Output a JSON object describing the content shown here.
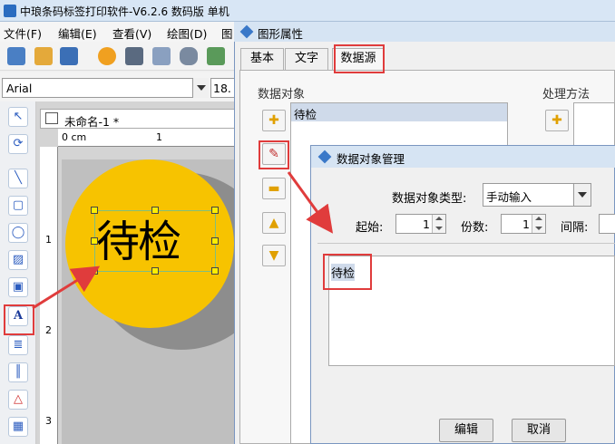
{
  "app": {
    "title": "中琅条码标签打印软件-V6.2.6 数码版 单机",
    "menu": [
      "文件(F)",
      "编辑(E)",
      "查看(V)",
      "绘图(D)",
      "图"
    ]
  },
  "font_bar": {
    "font_name": "Arial",
    "font_size": "18."
  },
  "document": {
    "tab_label": "未命名-1 *",
    "ruler_unit": "0 cm",
    "ruler_ticks": [
      "1",
      "1",
      "2",
      "3"
    ],
    "label_text": "待检"
  },
  "property_dialog": {
    "title": "图形属性",
    "tabs": [
      "基本",
      "文字",
      "数据源"
    ],
    "active_tab": "数据源",
    "data_objects_label": "数据对象",
    "processing_label": "处理方法",
    "data_objects": [
      "待检"
    ]
  },
  "manager_dialog": {
    "title": "数据对象管理",
    "type_label": "数据对象类型:",
    "type_value": "手动输入",
    "start_label": "起始:",
    "start_value": "1",
    "copies_label": "份数:",
    "copies_value": "1",
    "interval_label": "间隔:",
    "content_value": "待检",
    "edit_button": "编辑",
    "cancel_button": "取消"
  },
  "colors": {
    "label_circle": "#f7c300",
    "highlight": "#e03c3c",
    "title_bar": "#d6e4f3"
  }
}
